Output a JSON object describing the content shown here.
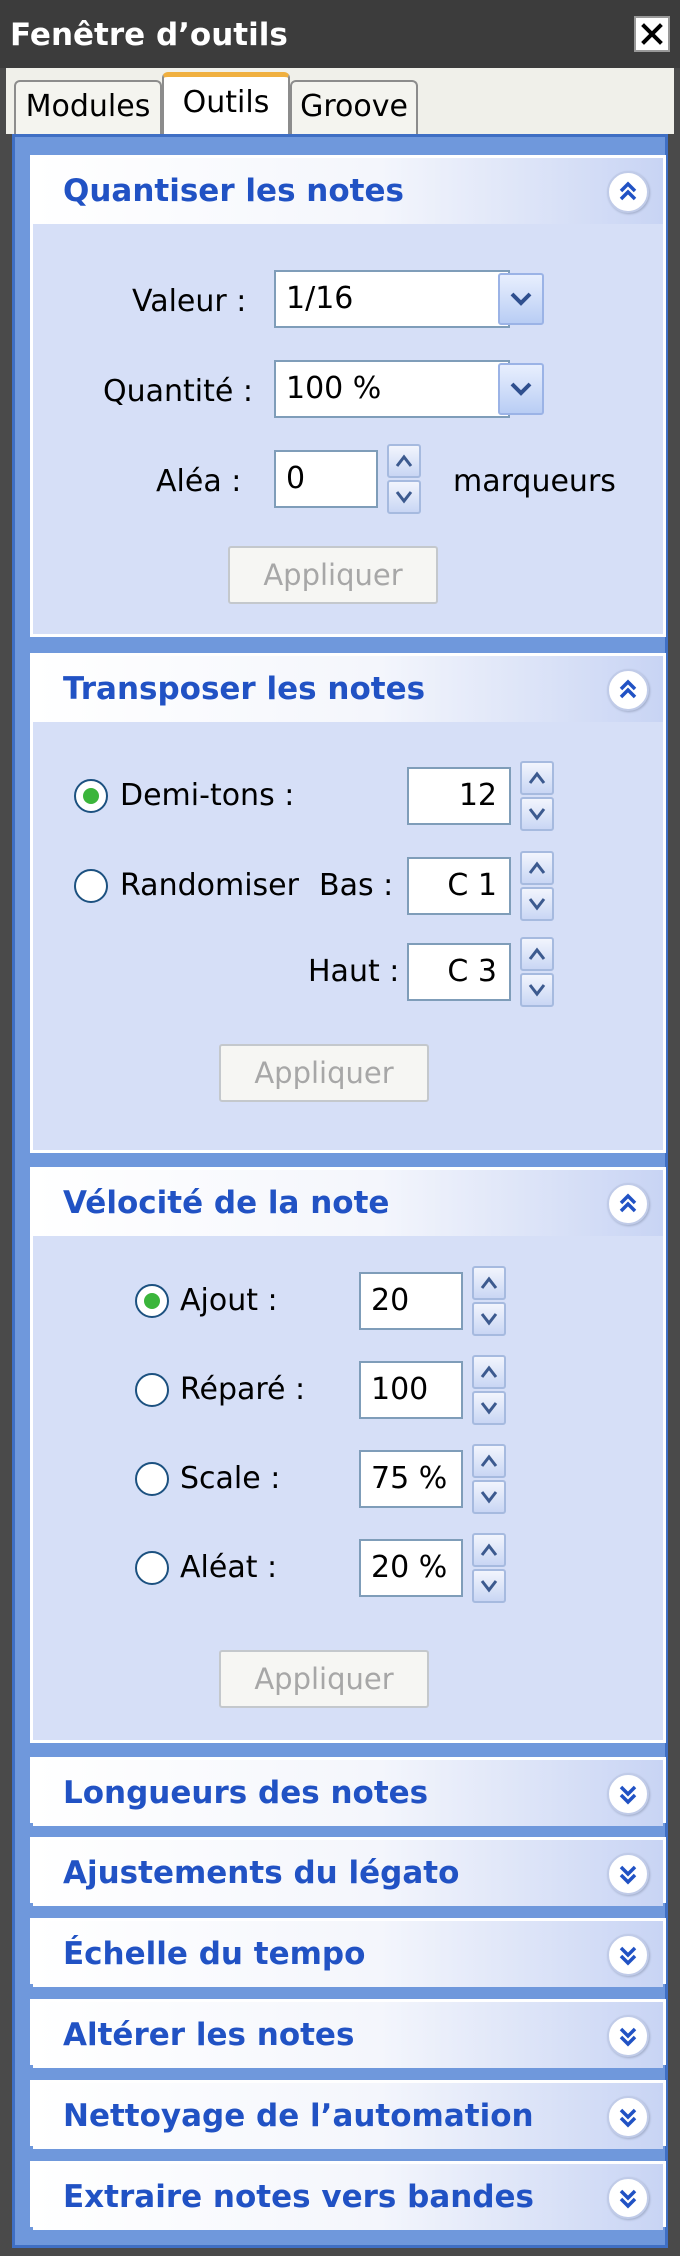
{
  "window": {
    "title": "Fenêtre d’outils"
  },
  "tabs": [
    {
      "label": "Modules",
      "active": false
    },
    {
      "label": "Outils",
      "active": true
    },
    {
      "label": "Groove",
      "active": false
    }
  ],
  "quantize": {
    "title": "Quantiser les notes",
    "valeur_label": "Valeur :",
    "valeur_value": "1/16",
    "quantite_label": "Quantité :",
    "quantite_value": "100 %",
    "alea_label": "Aléa :",
    "alea_value": "0",
    "alea_unit": "marqueurs",
    "apply": "Appliquer"
  },
  "transpose": {
    "title": "Transposer les notes",
    "demitons_label": "Demi-tons :",
    "demitons_value": "12",
    "randomiser_label": "Randomiser",
    "bas_label": "Bas :",
    "bas_value": "C 1",
    "haut_label": "Haut :",
    "haut_value": "C 3",
    "selected": "demitons",
    "apply": "Appliquer"
  },
  "velocity": {
    "title": "Vélocité de la note",
    "ajout_label": "Ajout :",
    "ajout_value": "20",
    "repare_label": "Réparé :",
    "repare_value": "100",
    "scale_label": "Scale :",
    "scale_value": "75 %",
    "aleat_label": "Aléat :",
    "aleat_value": "20 %",
    "selected": "ajout",
    "apply": "Appliquer"
  },
  "collapsed_panels": [
    "Longueurs des notes",
    "Ajustements du légato",
    "Échelle du tempo",
    "Altérer les notes",
    "Nettoyage de l’automation",
    "Extraire notes vers bandes"
  ],
  "colors": {
    "header_text": "#2152c4",
    "panel_bg": "#d6dff7",
    "frame_bg": "#6f98dc",
    "radio_dot": "#3bb53b",
    "active_tab_accent": "#f0b040"
  },
  "icons": {
    "close": "close-icon",
    "collapse": "chevron-double-up-icon",
    "expand": "chevron-double-down-icon",
    "dropdown": "chevron-down-icon",
    "spin_up": "triangle-up-icon",
    "spin_down": "triangle-down-icon"
  }
}
